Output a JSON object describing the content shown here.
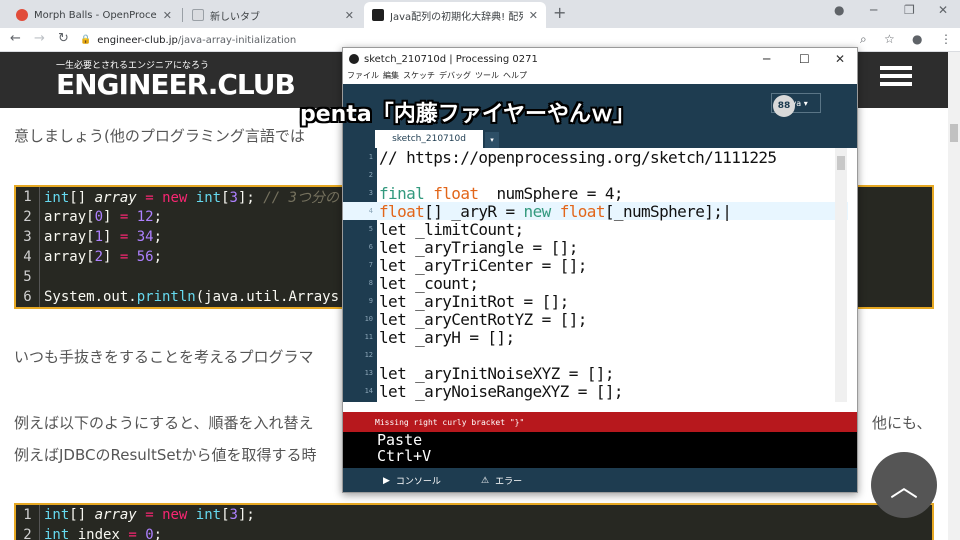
{
  "browser": {
    "tabs": [
      {
        "title": "Morph Balls - OpenProcessing",
        "favicon_color": "#e14c3a"
      },
      {
        "title": "新しいタブ",
        "favicon_color": "#dadce0"
      },
      {
        "title": "Java配列の初期化大辞典! 配列の初",
        "favicon_color": "#1f1f1f"
      }
    ],
    "new_tab": "+",
    "url_host": "engineer-club.jp",
    "url_path": "/java-array-initialization"
  },
  "site": {
    "tagline": "一生必要とされるエンジニアになろう",
    "logo": "ENGINEER.CLUB",
    "para1": "意しましょう(他のプログラミング言語では",
    "para2": "いつも手抜きをすることを考えるプログラマ",
    "para3a": "例えば以下のようにすると、順番を入れ替え",
    "para3a_right": "他にも、",
    "para3b": "例えばJDBCのResultSetから値を取得する時",
    "code1": {
      "nums": [
        "1",
        "2",
        "3",
        "4",
        "5",
        "6"
      ],
      "comment": "// 3つ分の"
    },
    "code2": {
      "nums": [
        "1",
        "2"
      ]
    }
  },
  "processing": {
    "title": "sketch_210710d | Processing 0271",
    "menu": [
      "ファイル",
      "編集",
      "スケッチ",
      "デバッグ",
      "ツール",
      "ヘルプ"
    ],
    "mode": "Java ▾",
    "debug": "88",
    "tab": "sketch_210710d",
    "tab_arrow": "▾",
    "line_numbers": [
      "1",
      "2",
      "3",
      "4",
      "5",
      "6",
      "7",
      "8",
      "9",
      "10",
      "11",
      "12",
      "13",
      "14"
    ],
    "code_comment": "// https://openprocessing.org/sketch/1111225",
    "error": "Missing right curly bracket \"}\"",
    "console_lines": [
      "Paste",
      "Ctrl+V"
    ],
    "footer_console": "コンソール",
    "footer_errors": "エラー"
  },
  "caption": "penta「内藤ファイヤーやんｗ」",
  "scroll_top": "︿"
}
